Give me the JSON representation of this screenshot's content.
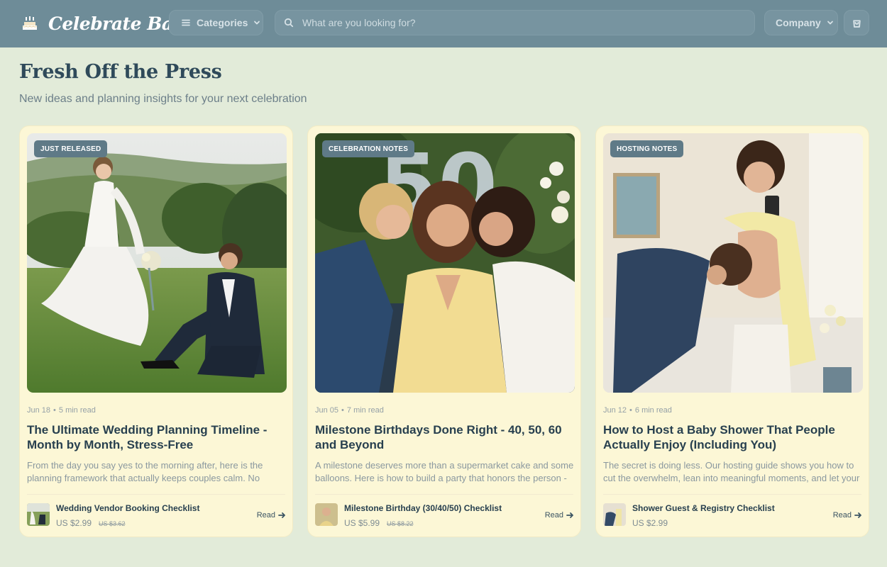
{
  "header": {
    "brand": "Celebrate Bay",
    "categories_label": "Categories",
    "search_placeholder": "What are you looking for?",
    "company_label": "Company"
  },
  "section": {
    "title": "Fresh Off the Press",
    "subtitle": "New ideas and planning insights for your next celebration"
  },
  "articles": [
    {
      "badge": "JUST RELEASED",
      "date": "Jun 18",
      "read_time": "5 min read",
      "title": "The Ultimate Wedding Planning Timeline - Month by Month, Stress-Free",
      "excerpt": "From the day you say yes to the morning after, here is the planning framework that actually keeps couples calm. No",
      "product": {
        "name": "Wedding Vendor Booking Checklist",
        "price": "US $2.99",
        "old_price": "US $3.62"
      },
      "cta": "Read"
    },
    {
      "badge": "CELEBRATION NOTES",
      "date": "Jun 05",
      "read_time": "7 min read",
      "title": "Milestone Birthdays Done Right - 40, 50, 60 and Beyond",
      "excerpt": "A milestone deserves more than a supermarket cake and some balloons. Here is how to build a party that honors the person -",
      "balloon_text": "50",
      "product": {
        "name": "Milestone Birthday (30/40/50) Checklist",
        "price": "US $5.99",
        "old_price": "US $8.22"
      },
      "cta": "Read"
    },
    {
      "badge": "HOSTING NOTES",
      "date": "Jun 12",
      "read_time": "6 min read",
      "title": "How to Host a Baby Shower That People Actually Enjoy (Including You)",
      "excerpt": "The secret is doing less. Our hosting guide shows you how to cut the overwhelm, lean into meaningful moments, and let your",
      "product": {
        "name": "Shower Guest & Registry Checklist",
        "price": "US $2.99"
      },
      "cta": "Read"
    }
  ],
  "colors": {
    "topbar": "#6e8c98",
    "page_bg": "#e2ebd9",
    "card_bg": "#fcf7d6",
    "badge_bg": "#5f7a87",
    "title_text": "#2f4a5a"
  },
  "icons": [
    "cake-icon",
    "menu-icon",
    "chevron-down-icon",
    "search-icon",
    "cart-icon",
    "arrow-right-icon"
  ]
}
